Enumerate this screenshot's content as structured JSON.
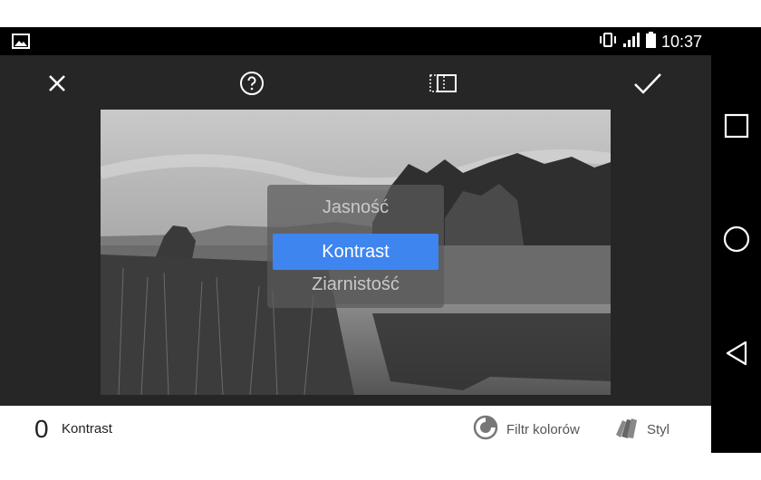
{
  "status_bar": {
    "time": "10:37",
    "icons": [
      "gallery-icon",
      "vibrate-icon",
      "signal-icon",
      "battery-icon"
    ]
  },
  "toolbar": {
    "icons": [
      "close-icon",
      "help-icon",
      "crop-icon",
      "check-icon"
    ]
  },
  "adjustment_picker": {
    "items": [
      "Jasność",
      "Kontrast",
      "Ziarnistość"
    ],
    "selected": "Kontrast"
  },
  "bottom_bar": {
    "value": "0",
    "parameter_label": "Kontrast",
    "actions": [
      {
        "label": "Filtr kolorów",
        "icon": "color-filter-icon"
      },
      {
        "label": "Styl",
        "icon": "style-icon"
      }
    ]
  },
  "nav_bar": {
    "icons": [
      "recents-icon",
      "home-icon",
      "back-icon"
    ]
  },
  "colors": {
    "accent": "#3e85f0",
    "toolbar_bg": "#262626",
    "status_bg": "#000000"
  }
}
